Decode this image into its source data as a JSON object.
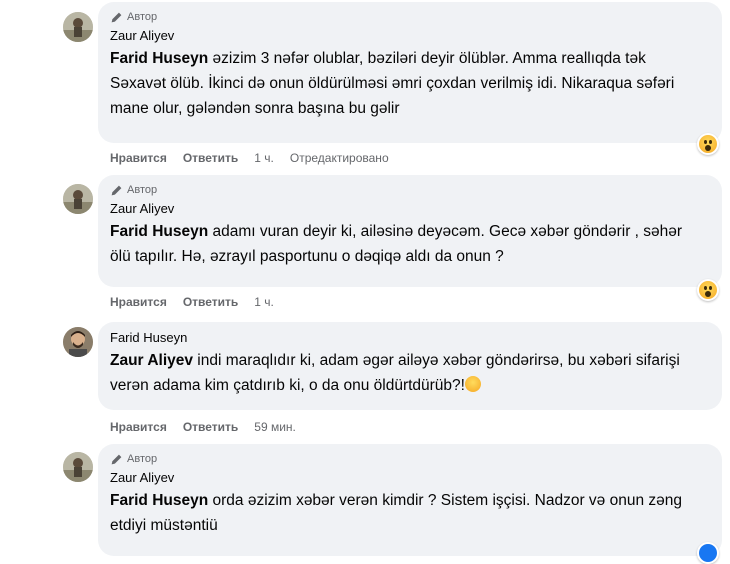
{
  "author_badge": "Автор",
  "actions": {
    "like": "Нравится",
    "reply": "Ответить"
  },
  "comments": [
    {
      "author": "Zaur Aliyev",
      "mention": "Farid Huseyn",
      "text_line1": " əzizim 3 nəfər olublar, bəziləri deyir ölüblər. Amma reallıqda tək",
      "text_line2": "Səxavət ölüb. İkinci də onun öldürülməsi əmri çoxdan verilmiş idi. Nikaraqua səfəri",
      "text_line3": "mane olur, gələndən sonra başına bu gəlir",
      "time": "1 ч.",
      "edited": "Отредактировано",
      "reaction": "wow-emoji"
    },
    {
      "author": "Zaur Aliyev",
      "mention": "Farid Huseyn",
      "text_line1": " adamı vuran deyir ki, ailəsinə deyəcəm. Gecə xəbər göndərir , səhər",
      "text_line2": "ölü tapılır. Hə, əzrayıl pasportunu o dəqiqə aldı da onun ?",
      "time": "1 ч.",
      "reaction": "wow-emoji"
    },
    {
      "author": "Farid Huseyn",
      "mention": "Zaur Aliyev",
      "text_line1": " indi maraqlıdır ki, adam əgər ailəyə xəbər göndərirsə, bu xəbəri sifarişi",
      "text_line2": "verən adama kim çatdırıb ki, o da onu öldürtdürüb?!",
      "time": "59 мин."
    },
    {
      "author": "Zaur Aliyev",
      "mention": "Farid Huseyn",
      "text_line1": " orda əzizim xəbər verən kimdir ? Sistem işçisi. Nadzor və onun zəng",
      "text_line2": "etdiyi müstəntiü"
    }
  ]
}
